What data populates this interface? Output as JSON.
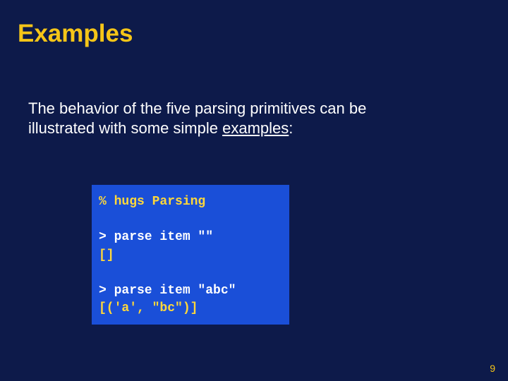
{
  "title": "Examples",
  "body": {
    "line1": "The behavior of the five parsing primitives can be",
    "line2_pre": "illustrated with some simple ",
    "line2_link": "examples",
    "line2_post": ":"
  },
  "code": {
    "l1": "% hugs Parsing",
    "blank1": "",
    "l2": "> parse item \"\"",
    "l3": "[]",
    "blank2": "",
    "l4": "> parse item \"abc\"",
    "l5": "[('a', \"bc\")]"
  },
  "page_number": "9"
}
